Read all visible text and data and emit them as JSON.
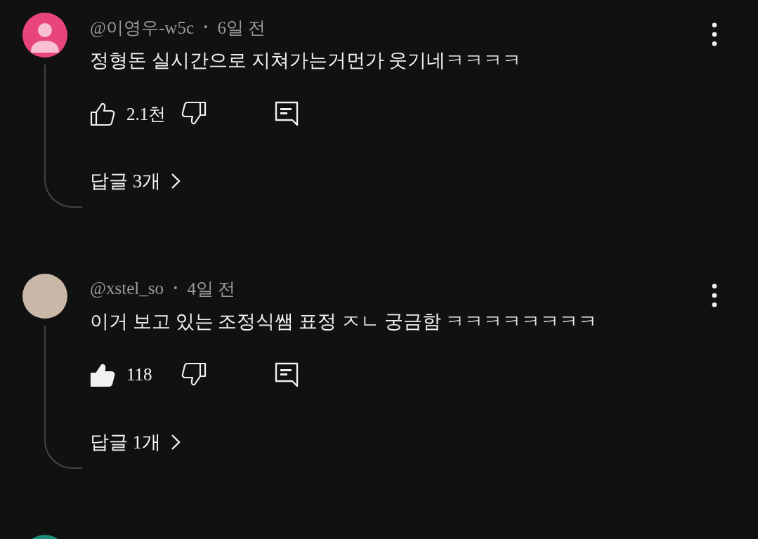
{
  "comments": [
    {
      "avatar": {
        "kind": "default",
        "color": "#e8457f"
      },
      "author": "@이영우-w5c",
      "separator": "•",
      "time": "6일 전",
      "text": "정형돈 실시간으로 지쳐가는거먼가 웃기네ㅋㅋㅋㅋ",
      "likes": "2.1천",
      "liked": false,
      "replies": "답글 3개"
    },
    {
      "avatar": {
        "kind": "photo",
        "color": "#c9b8a8"
      },
      "author": "@xstel_so",
      "separator": "•",
      "time": "4일 전",
      "text": "이거 보고 있는 조정식쌤 표정 ㅈㄴ 궁금함 ㅋㅋㅋㅋㅋㅋㅋㅋ",
      "likes": "118",
      "liked": true,
      "replies": "답글 1개"
    }
  ],
  "next_avatar": {
    "color": "#1a8c7a"
  }
}
